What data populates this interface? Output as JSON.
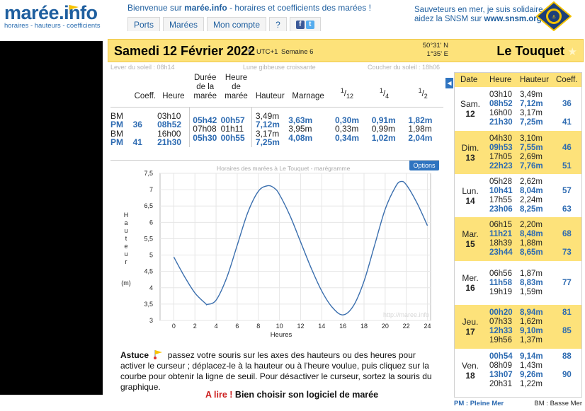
{
  "header": {
    "logo_name": "marée.info",
    "logo_tagline": "horaires - hauteurs - coefficients",
    "welcome_prefix": "Bienvenue sur ",
    "welcome_site": "marée.info",
    "welcome_suffix": " - horaires et coefficients des marées !",
    "nav": [
      "Ports",
      "Marées",
      "Mon compte",
      "?"
    ],
    "snsm_line1": "Sauveteurs en mer, je suis solidaire",
    "snsm_line2_prefix": "aidez la SNSM sur ",
    "snsm_url": "www.snsm.org",
    "badge_text": "LES SAUVETEURS EN MER · SNSM"
  },
  "datebar": {
    "date": "Samedi 12 Février 2022",
    "utc": "UTC+1",
    "week": "Semaine 6",
    "lat": "50°31' N",
    "lon": "1°35' E",
    "city": "Le Touquet"
  },
  "sunline": {
    "sunrise": "Lever du soleil : 08h14",
    "moon": "Lune gibbeuse croissante",
    "sunset": "Coucher du soleil : 18h06"
  },
  "tide_table": {
    "headers": {
      "coeff": "Coeff.",
      "heure": "Heure",
      "duree": [
        "Durée",
        "de la",
        "marée"
      ],
      "heure_maree": [
        "Heure",
        "de",
        "marée"
      ],
      "hauteur": "Hauteur",
      "marnage": "Marnage",
      "f12": "1/12",
      "f4": "1/4",
      "f2": "1/2"
    },
    "rows": [
      {
        "type": "BM",
        "coeff": "",
        "heure": "03h10",
        "hauteur": "3,49m",
        "highlight": false
      },
      {
        "type": "PM",
        "coeff": "36",
        "heure": "08h52",
        "hauteur": "7,12m",
        "highlight": true
      },
      {
        "type": "BM",
        "coeff": "",
        "heure": "16h00",
        "hauteur": "3,17m",
        "highlight": false
      },
      {
        "type": "PM",
        "coeff": "41",
        "heure": "21h30",
        "hauteur": "7,25m",
        "highlight": true
      }
    ],
    "intervals": [
      {
        "duree": "05h42",
        "heure_maree": "00h57",
        "marnage": "3,63m",
        "f12": "0,30m",
        "f4": "0,91m",
        "f2": "1,82m",
        "highlight": true
      },
      {
        "duree": "07h08",
        "heure_maree": "01h11",
        "marnage": "3,95m",
        "f12": "0,33m",
        "f4": "0,99m",
        "f2": "1,98m",
        "highlight": false
      },
      {
        "duree": "05h30",
        "heure_maree": "00h55",
        "marnage": "4,08m",
        "f12": "0,34m",
        "f4": "1,02m",
        "f2": "2,04m",
        "highlight": true
      }
    ]
  },
  "chart_data": {
    "type": "line",
    "title": "Horaires des marées à Le Touquet - marégramme",
    "xlabel": "Heures",
    "ylabel": [
      "H",
      "a",
      "u",
      "t",
      "e",
      "u",
      "r",
      "(m)"
    ],
    "watermark": "http://maree.info",
    "options_label": "Options",
    "xlim": [
      -2,
      25
    ],
    "ylim": [
      3,
      7.5
    ],
    "x_ticks": [
      0,
      2,
      4,
      6,
      8,
      10,
      12,
      14,
      16,
      18,
      20,
      22,
      24
    ],
    "y_ticks": [
      "7,5",
      "7",
      "6,5",
      "6",
      "5,5",
      "5",
      "4,5",
      "4",
      "3,5",
      "3"
    ],
    "y_tick_values": [
      7.5,
      7,
      6.5,
      6,
      5.5,
      5,
      4.5,
      4,
      3.5,
      3
    ],
    "series": [
      {
        "x": [
          0,
          1,
          2,
          3,
          3.17,
          4,
          5,
          6,
          7,
          8,
          8.87,
          9.5,
          10,
          11,
          12,
          13,
          14,
          15,
          16,
          17,
          18,
          19,
          20,
          21,
          21.5,
          22,
          23,
          24
        ],
        "y": [
          4.94,
          4.35,
          3.84,
          3.52,
          3.49,
          3.62,
          4.3,
          5.3,
          6.3,
          6.95,
          7.12,
          7.05,
          6.85,
          6.2,
          5.4,
          4.6,
          3.9,
          3.4,
          3.17,
          3.45,
          4.2,
          5.3,
          6.4,
          7.1,
          7.25,
          7.15,
          6.6,
          5.9
        ]
      }
    ],
    "grid": true
  },
  "astuce": {
    "label": "Astuce",
    "text": "passez votre souris sur les axes des hauteurs ou des heures pour activer le curseur ; déplacez-le à la hauteur ou à l'heure voulue, puis cliquez sur la courbe pour obtenir la ligne de seuil. Pour désactiver le curseur, sortez la souris du graphique."
  },
  "alire": {
    "prefix": "A lire !",
    "text": "Bien choisir son logiciel de marée"
  },
  "tide_panel": {
    "headers": {
      "date": "Date",
      "heure": "Heure",
      "hauteur": "Hauteur",
      "coeff": "Coeff."
    },
    "days": [
      {
        "day": "Sam.",
        "num": "12",
        "yellow": false,
        "tides": [
          {
            "heure": "03h10",
            "hauteur": "3,49m",
            "coeff": "",
            "pm": false
          },
          {
            "heure": "08h52",
            "hauteur": "7,12m",
            "coeff": "36",
            "pm": true
          },
          {
            "heure": "16h00",
            "hauteur": "3,17m",
            "coeff": "",
            "pm": false
          },
          {
            "heure": "21h30",
            "hauteur": "7,25m",
            "coeff": "41",
            "pm": true
          }
        ]
      },
      {
        "day": "Dim.",
        "num": "13",
        "yellow": true,
        "tides": [
          {
            "heure": "04h30",
            "hauteur": "3,10m",
            "coeff": "",
            "pm": false
          },
          {
            "heure": "09h53",
            "hauteur": "7,55m",
            "coeff": "46",
            "pm": true
          },
          {
            "heure": "17h05",
            "hauteur": "2,69m",
            "coeff": "",
            "pm": false
          },
          {
            "heure": "22h23",
            "hauteur": "7,76m",
            "coeff": "51",
            "pm": true
          }
        ]
      },
      {
        "day": "Lun.",
        "num": "14",
        "yellow": false,
        "tides": [
          {
            "heure": "05h28",
            "hauteur": "2,62m",
            "coeff": "",
            "pm": false
          },
          {
            "heure": "10h41",
            "hauteur": "8,04m",
            "coeff": "57",
            "pm": true
          },
          {
            "heure": "17h55",
            "hauteur": "2,24m",
            "coeff": "",
            "pm": false
          },
          {
            "heure": "23h06",
            "hauteur": "8,25m",
            "coeff": "63",
            "pm": true
          }
        ]
      },
      {
        "day": "Mar.",
        "num": "15",
        "yellow": true,
        "tides": [
          {
            "heure": "06h15",
            "hauteur": "2,20m",
            "coeff": "",
            "pm": false
          },
          {
            "heure": "11h21",
            "hauteur": "8,48m",
            "coeff": "68",
            "pm": true
          },
          {
            "heure": "18h39",
            "hauteur": "1,88m",
            "coeff": "",
            "pm": false
          },
          {
            "heure": "23h44",
            "hauteur": "8,65m",
            "coeff": "73",
            "pm": true
          }
        ]
      },
      {
        "day": "Mer.",
        "num": "16",
        "yellow": false,
        "tides": [
          {
            "heure": "06h56",
            "hauteur": "1,87m",
            "coeff": "",
            "pm": false
          },
          {
            "heure": "11h58",
            "hauteur": "8,83m",
            "coeff": "77",
            "pm": true
          },
          {
            "heure": "19h19",
            "hauteur": "1,59m",
            "coeff": "",
            "pm": false
          }
        ]
      },
      {
        "day": "Jeu.",
        "num": "17",
        "yellow": true,
        "tides": [
          {
            "heure": "00h20",
            "hauteur": "8,94m",
            "coeff": "81",
            "pm": true
          },
          {
            "heure": "07h33",
            "hauteur": "1,62m",
            "coeff": "",
            "pm": false
          },
          {
            "heure": "12h33",
            "hauteur": "9,10m",
            "coeff": "85",
            "pm": true
          },
          {
            "heure": "19h56",
            "hauteur": "1,37m",
            "coeff": "",
            "pm": false
          }
        ]
      },
      {
        "day": "Ven.",
        "num": "18",
        "yellow": false,
        "tides": [
          {
            "heure": "00h54",
            "hauteur": "9,14m",
            "coeff": "88",
            "pm": true
          },
          {
            "heure": "08h09",
            "hauteur": "1,43m",
            "coeff": "",
            "pm": false
          },
          {
            "heure": "13h07",
            "hauteur": "9,26m",
            "coeff": "90",
            "pm": true
          },
          {
            "heure": "20h31",
            "hauteur": "1,22m",
            "coeff": "",
            "pm": false
          }
        ]
      }
    ],
    "legend_pm": "PM : Pleine Mer",
    "legend_bm": "BM : Basse Mer"
  },
  "colors": {
    "accent": "#2c6ab1",
    "yellow": "#fde27a",
    "red": "#cc1f1f"
  }
}
